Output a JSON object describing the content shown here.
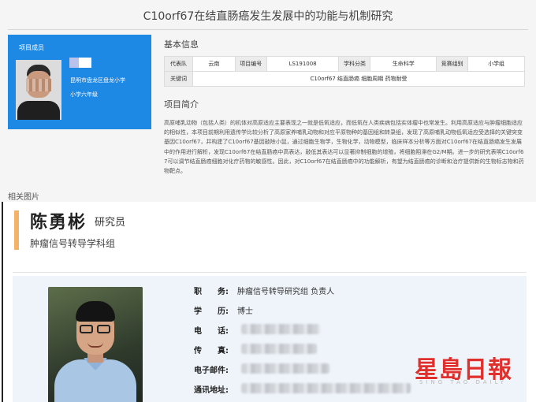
{
  "project": {
    "title": "C10orf67在结直肠癌发生发展中的功能与机制研究",
    "member_panel": {
      "heading": "项目成员",
      "school": "昆明市盘龙区盘龙小学",
      "grade": "小学六年级"
    },
    "basic_info": {
      "heading": "基本信息",
      "table": {
        "rep_label": "代表队",
        "rep_value": "云南",
        "id_label": "项目编号",
        "id_value": "LS191008",
        "subject_label": "学科分类",
        "subject_value": "生命科学",
        "group_label": "竞赛组别",
        "group_value": "小学组",
        "keyword_label": "关键词",
        "keyword_value": "C10orf67 结直肠癌 细胞周期 药物耐受"
      }
    },
    "intro": {
      "heading": "项目简介",
      "text": "高原哺乳动物（包括人类）的机体对高原适应主要表现之一就是低氧适应，而低氧在人类疾病包括实体瘤中也常发生。利用高原适应与肿瘤细胞适应的相似性，本项目前期利用遗传学比较分析了高原家养哺乳动物和对应平原物种的基因组和转录组，发现了高原哺乳动物低氧适应受选择的关键突变基因C10orf67，并构建了C10orf67基因敲除小鼠，通过细胞生物学，生物化学，动物模型，临床样本分析等方面对C10orf67在结直肠癌发生发展中的作用进行解析，发现C10orf67在结直肠癌中高表达，敲低其表达可以显著抑制细胞的增殖，将细胞阻滞在G2/M期。进一步的研究表明C10orf67可以调节结直肠癌细胞对化疗药物的敏感性。因此，对C10orf67在结直肠癌中的功能解析，有望为结直肠癌的诊断和治疗提供新的生物标志物和药物靶点。"
    },
    "related_images_label": "相关图片"
  },
  "profile": {
    "name": "陈勇彬",
    "role": "研究员",
    "department": "肿瘤信号转导学科组",
    "fields": {
      "position_label": "职　　务:",
      "position_value": "肿瘤信号转导研究组 负责人",
      "education_label": "学　　历:",
      "education_value": "博士",
      "phone_label": "电　　话:",
      "fax_label": "传　　真:",
      "email_label": "电子邮件:",
      "address_label": "通讯地址:"
    }
  },
  "watermark": {
    "chinese": "星島日報",
    "english": "SING TAO DAILY"
  },
  "colors": {
    "member_panel": "#1e88e5",
    "accent_bar": "#f4b266",
    "watermark_red": "#e0302e",
    "card_bg": "#eef4fa"
  }
}
